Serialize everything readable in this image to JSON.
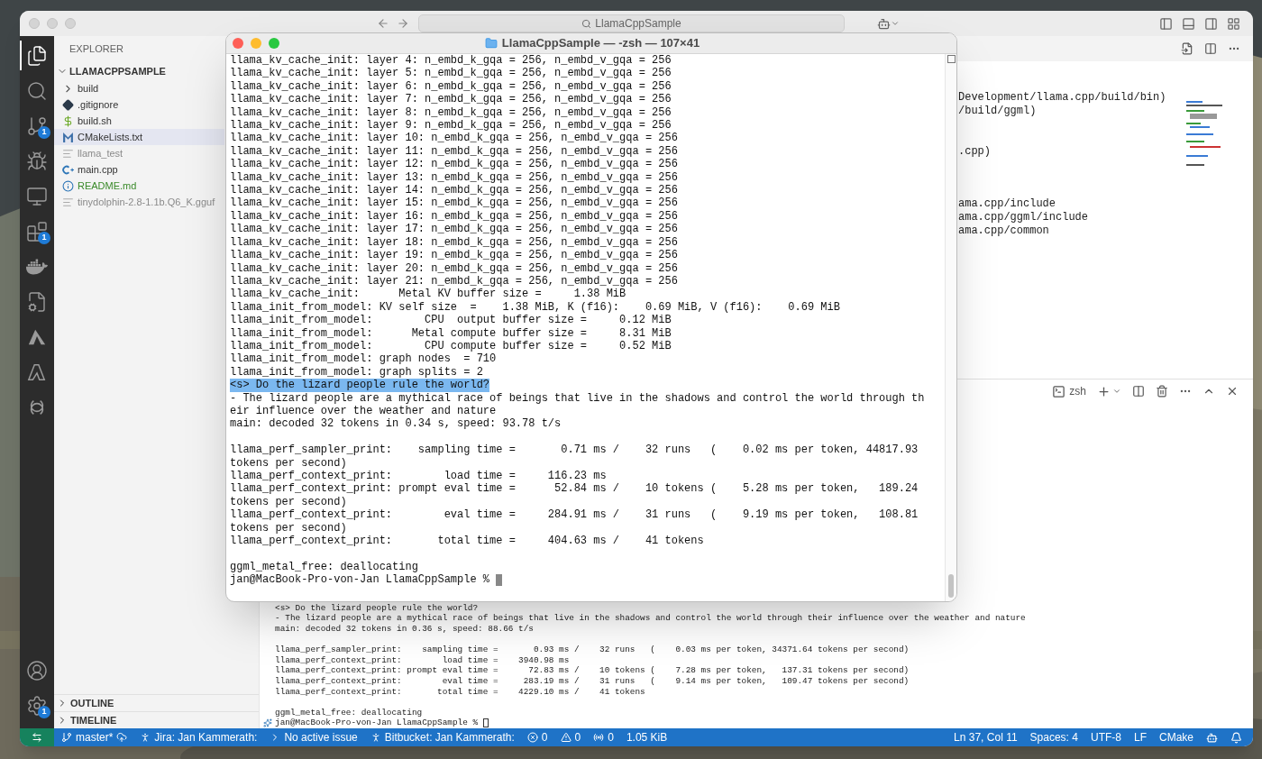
{
  "titlebar": {
    "search": "LlamaCppSample"
  },
  "activity_bar": [
    {
      "kind": "files",
      "selected": true
    },
    {
      "kind": "search",
      "selected": false
    },
    {
      "kind": "source-control",
      "selected": false,
      "badge": "1"
    },
    {
      "kind": "run-debug",
      "selected": false
    },
    {
      "kind": "remote",
      "selected": false
    },
    {
      "kind": "extensions",
      "selected": false,
      "badge": "1"
    },
    {
      "kind": "docker",
      "selected": false
    },
    {
      "kind": "cmake",
      "selected": false
    },
    {
      "kind": "triangle",
      "selected": false
    },
    {
      "kind": "letter",
      "selected": false
    },
    {
      "kind": "ring",
      "selected": false
    }
  ],
  "activity_bottom": [
    {
      "kind": "account"
    },
    {
      "kind": "settings",
      "badge": "1"
    }
  ],
  "sidebar": {
    "title": "EXPLORER",
    "folder": "LLAMACPPSAMPLE",
    "items": [
      {
        "name": "build",
        "kind": "folder",
        "color": "#333333",
        "selected": false
      },
      {
        "name": ".gitignore",
        "kind": "gitignore",
        "color": "#333333",
        "selected": false
      },
      {
        "name": "build.sh",
        "kind": "shell",
        "color": "#333333",
        "selected": false
      },
      {
        "name": "CMakeLists.txt",
        "kind": "cmake",
        "color": "#333333",
        "selected": true
      },
      {
        "name": "llama_test",
        "kind": "text",
        "color": "#8a8a8a",
        "selected": false
      },
      {
        "name": "main.cpp",
        "kind": "cpp",
        "color": "#333333",
        "selected": false
      },
      {
        "name": "README.md",
        "kind": "info",
        "color": "#3a8a2a",
        "selected": false
      },
      {
        "name": "tinydolphin-2.8-1.1b.Q6_K.gguf",
        "kind": "text",
        "color": "#8a8a8a",
        "selected": false
      }
    ],
    "sections": [
      "OUTLINE",
      "TIMELINE"
    ]
  },
  "editor": {
    "code_groups": [
      [
        "Development/llama.cpp/build/bin)",
        "/build/ggml)"
      ],
      [
        ".cpp)"
      ],
      [
        "ama.cpp/include",
        "ama.cpp/ggml/include",
        "ama.cpp/common"
      ]
    ]
  },
  "panel": {
    "shell": "zsh",
    "blocks": [
      [
        "<s> Do the lizard people rule the world?",
        "- The lizard people are a mythical race of beings that live in the shadows and control the world through their influence over the weather and nature",
        "main: decoded 32 tokens in 0.36 s, speed: 88.66 t/s"
      ],
      [
        "llama_perf_sampler_print:    sampling time =       0.93 ms /    32 runs   (    0.03 ms per token, 34371.64 tokens per second)",
        "llama_perf_context_print:        load time =    3940.98 ms",
        "llama_perf_context_print: prompt eval time =      72.83 ms /    10 tokens (    7.28 ms per token,   137.31 tokens per second)",
        "llama_perf_context_print:        eval time =     283.19 ms /    31 runs   (    9.14 ms per token,   109.47 tokens per second)",
        "llama_perf_context_print:       total time =    4229.10 ms /    41 tokens"
      ],
      [
        "ggml_metal_free: deallocating"
      ]
    ],
    "prompt": "jan@MacBook-Pro-von-Jan LlamaCppSample % "
  },
  "status_bar": {
    "left": [
      {
        "kind": "branch",
        "text": "master*"
      },
      {
        "kind": "person",
        "text": "Jira: Jan Kammerath:"
      },
      {
        "kind": "chevron",
        "text": "No active issue"
      },
      {
        "kind": "person",
        "text": "Bitbucket: Jan Kammerath:"
      },
      {
        "kind": "errors",
        "text": "0"
      },
      {
        "kind": "warnings",
        "text": "0"
      },
      {
        "kind": "ports",
        "text": "0"
      },
      {
        "kind": "plain",
        "text": "1.05 KiB"
      }
    ],
    "right": [
      "Ln 37, Col 11",
      "Spaces: 4",
      "UTF-8",
      "LF",
      "CMake"
    ]
  },
  "terminal_window": {
    "title": "LlamaCppSample — -zsh — 107×41",
    "blocks": [
      [
        {
          "text": "llama_kv_cache_init: layer 4: n_embd_k_gqa = 256, n_embd_v_gqa = 256",
          "selected": false
        },
        {
          "text": "llama_kv_cache_init: layer 5: n_embd_k_gqa = 256, n_embd_v_gqa = 256",
          "selected": false
        },
        {
          "text": "llama_kv_cache_init: layer 6: n_embd_k_gqa = 256, n_embd_v_gqa = 256",
          "selected": false
        },
        {
          "text": "llama_kv_cache_init: layer 7: n_embd_k_gqa = 256, n_embd_v_gqa = 256",
          "selected": false
        },
        {
          "text": "llama_kv_cache_init: layer 8: n_embd_k_gqa = 256, n_embd_v_gqa = 256",
          "selected": false
        },
        {
          "text": "llama_kv_cache_init: layer 9: n_embd_k_gqa = 256, n_embd_v_gqa = 256",
          "selected": false
        },
        {
          "text": "llama_kv_cache_init: layer 10: n_embd_k_gqa = 256, n_embd_v_gqa = 256",
          "selected": false
        },
        {
          "text": "llama_kv_cache_init: layer 11: n_embd_k_gqa = 256, n_embd_v_gqa = 256",
          "selected": false
        },
        {
          "text": "llama_kv_cache_init: layer 12: n_embd_k_gqa = 256, n_embd_v_gqa = 256",
          "selected": false
        },
        {
          "text": "llama_kv_cache_init: layer 13: n_embd_k_gqa = 256, n_embd_v_gqa = 256",
          "selected": false
        },
        {
          "text": "llama_kv_cache_init: layer 14: n_embd_k_gqa = 256, n_embd_v_gqa = 256",
          "selected": false
        },
        {
          "text": "llama_kv_cache_init: layer 15: n_embd_k_gqa = 256, n_embd_v_gqa = 256",
          "selected": false
        },
        {
          "text": "llama_kv_cache_init: layer 16: n_embd_k_gqa = 256, n_embd_v_gqa = 256",
          "selected": false
        },
        {
          "text": "llama_kv_cache_init: layer 17: n_embd_k_gqa = 256, n_embd_v_gqa = 256",
          "selected": false
        },
        {
          "text": "llama_kv_cache_init: layer 18: n_embd_k_gqa = 256, n_embd_v_gqa = 256",
          "selected": false
        },
        {
          "text": "llama_kv_cache_init: layer 19: n_embd_k_gqa = 256, n_embd_v_gqa = 256",
          "selected": false
        },
        {
          "text": "llama_kv_cache_init: layer 20: n_embd_k_gqa = 256, n_embd_v_gqa = 256",
          "selected": false
        },
        {
          "text": "llama_kv_cache_init: layer 21: n_embd_k_gqa = 256, n_embd_v_gqa = 256",
          "selected": false
        },
        {
          "text": "llama_kv_cache_init:      Metal KV buffer size =     1.38 MiB",
          "selected": false
        },
        {
          "text": "llama_init_from_model: KV self size  =    1.38 MiB, K (f16):    0.69 MiB, V (f16):    0.69 MiB",
          "selected": false
        },
        {
          "text": "llama_init_from_model:        CPU  output buffer size =     0.12 MiB",
          "selected": false
        },
        {
          "text": "llama_init_from_model:      Metal compute buffer size =     8.31 MiB",
          "selected": false
        },
        {
          "text": "llama_init_from_model:        CPU compute buffer size =     0.52 MiB",
          "selected": false
        },
        {
          "text": "llama_init_from_model: graph nodes  = 710",
          "selected": false
        },
        {
          "text": "llama_init_from_model: graph splits = 2",
          "selected": false
        },
        {
          "text": "<s> Do the lizard people rule the world?",
          "selected": true
        },
        {
          "text": "- The lizard people are a mythical race of beings that live in the shadows and control the world through th",
          "selected": false
        },
        {
          "text": "eir influence over the weather and nature",
          "selected": false
        },
        {
          "text": "main: decoded 32 tokens in 0.34 s, speed: 93.78 t/s",
          "selected": false
        }
      ],
      [
        {
          "text": "llama_perf_sampler_print:    sampling time =       0.71 ms /    32 runs   (    0.02 ms per token, 44817.93",
          "selected": false
        },
        {
          "text": "tokens per second)",
          "selected": false
        },
        {
          "text": "llama_perf_context_print:        load time =     116.23 ms",
          "selected": false
        },
        {
          "text": "llama_perf_context_print: prompt eval time =      52.84 ms /    10 tokens (    5.28 ms per token,   189.24",
          "selected": false
        },
        {
          "text": "tokens per second)",
          "selected": false
        },
        {
          "text": "llama_perf_context_print:        eval time =     284.91 ms /    31 runs   (    9.19 ms per token,   108.81",
          "selected": false
        },
        {
          "text": "tokens per second)",
          "selected": false
        },
        {
          "text": "llama_perf_context_print:       total time =     404.63 ms /    41 tokens",
          "selected": false
        }
      ],
      [
        {
          "text": "ggml_metal_free: deallocating",
          "selected": false
        }
      ]
    ],
    "prompt": "jan@MacBook-Pro-von-Jan LlamaCppSample % "
  }
}
